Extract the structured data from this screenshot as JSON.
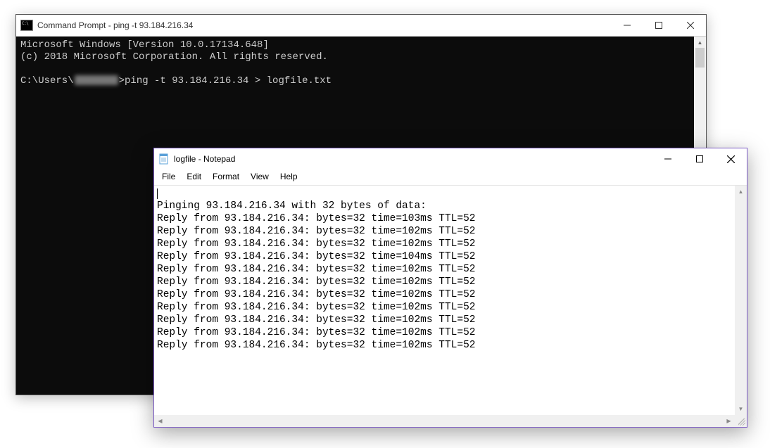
{
  "cmd": {
    "title": "Command Prompt - ping  -t 93.184.216.34",
    "line1": "Microsoft Windows [Version 10.0.17134.648]",
    "line2": "(c) 2018 Microsoft Corporation. All rights reserved.",
    "prompt_prefix": "C:\\Users\\",
    "prompt_suffix": ">ping -t 93.184.216.34 > logfile.txt"
  },
  "notepad": {
    "title": "logfile - Notepad",
    "menu": {
      "file": "File",
      "edit": "Edit",
      "format": "Format",
      "view": "View",
      "help": "Help"
    },
    "header_line": "Pinging 93.184.216.34 with 32 bytes of data:",
    "replies": [
      "Reply from 93.184.216.34: bytes=32 time=103ms TTL=52",
      "Reply from 93.184.216.34: bytes=32 time=102ms TTL=52",
      "Reply from 93.184.216.34: bytes=32 time=102ms TTL=52",
      "Reply from 93.184.216.34: bytes=32 time=104ms TTL=52",
      "Reply from 93.184.216.34: bytes=32 time=102ms TTL=52",
      "Reply from 93.184.216.34: bytes=32 time=102ms TTL=52",
      "Reply from 93.184.216.34: bytes=32 time=102ms TTL=52",
      "Reply from 93.184.216.34: bytes=32 time=102ms TTL=52",
      "Reply from 93.184.216.34: bytes=32 time=102ms TTL=52",
      "Reply from 93.184.216.34: bytes=32 time=102ms TTL=52",
      "Reply from 93.184.216.34: bytes=32 time=102ms TTL=52"
    ]
  }
}
